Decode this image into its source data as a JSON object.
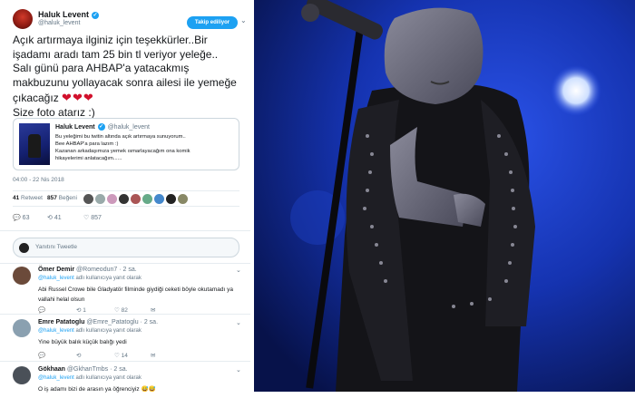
{
  "profile": {
    "name": "Haluk Levent",
    "verified_mark": "✓",
    "handle": "@haluk_levent",
    "follow_label": "Takip ediliyor"
  },
  "tweet": {
    "lines": [
      "Açık artırmaya ilginiz için teşekkürler..Bir",
      "işadamı aradı tam 25 bin tl veriyor yeleğe..",
      "Salı günü para AHBAP'a yatacakmış",
      "makbuzunu yollayacak sonra ailesi ile yemeğe",
      "çıkacağız"
    ],
    "hearts": "❤❤❤",
    "last_line": "Size foto atarız :)"
  },
  "quote": {
    "name": "Haluk Levent",
    "handle": "@haluk_levent",
    "lines": [
      "Bu yeleğimi bu twitin altında açık artırmaya sunuyorum..",
      "Bee AHBAP'a para lazım :)",
      "Kazanan arkadaşımıza yemek ısmarlayacağım ona komik",
      "hikayelerimi anlatacağım......"
    ]
  },
  "meta": {
    "date": "04:00 - 22 Nis 2018"
  },
  "stats": {
    "retweets": "41",
    "retweets_label": "Retweet",
    "likes": "857",
    "likes_label": "Beğeni"
  },
  "actions": {
    "reply_count": "63",
    "retweet_count": "41",
    "like_count": "857"
  },
  "reply_box": {
    "placeholder": "Yanıtını Tweetle"
  },
  "replies": [
    {
      "name": "Ömer Demir",
      "handle": "@Romeodun7 · 2 sa.",
      "to_handle": "@haluk_levent",
      "to_suffix": "adlı kullanıcıya yanıt olarak",
      "lines": [
        "Abi Russel Crowe bile Gladyatör filminde giydiği ceketi böyle okutamadı ya",
        "vallahi helal olsun"
      ],
      "retweets": "1",
      "likes": "82"
    },
    {
      "name": "Emre Patatoglu",
      "handle": "@Emre_Patatoglu · 2 sa.",
      "to_handle": "@haluk_levent",
      "to_suffix": "adlı kullanıcıya yanıt olarak",
      "lines": [
        "Yine büyük balık küçük balığı yedi"
      ],
      "retweets": "",
      "likes": "14"
    },
    {
      "name": "Gökhaan",
      "handle": "@GkhanTmbs · 2 sa.",
      "to_handle": "@haluk_levent",
      "to_suffix": "adlı kullanıcıya yanıt olarak",
      "lines": [
        "O iş adamı bizi de arasın ya öğrenciyiz 😅😅"
      ],
      "retweets": "",
      "likes": ""
    }
  ],
  "icons": {
    "reply": "reply-icon",
    "retweet": "retweet-icon",
    "like": "heart-icon",
    "caret": "chevron-down-icon"
  },
  "colors": {
    "accent": "#1da1f2",
    "heart": "#d1112c",
    "stage_blue": "#0e2a8c"
  }
}
